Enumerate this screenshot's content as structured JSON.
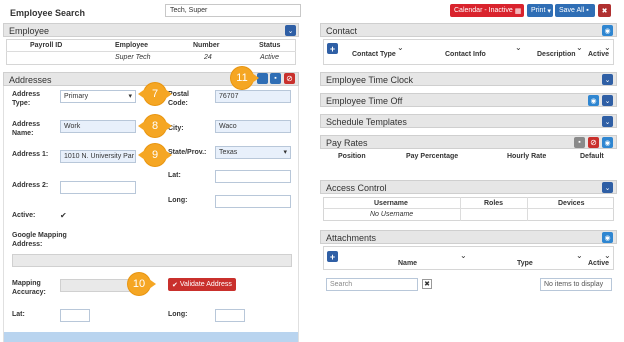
{
  "header": {
    "title": "Employee Search",
    "search_value": "Tech, Super",
    "calendar_label": "Calendar - Inactive",
    "print_label": "Print",
    "save_all_label": "Save All"
  },
  "employee": {
    "section_title": "Employee",
    "columns": [
      "Payroll ID",
      "Employee",
      "Number",
      "Status"
    ],
    "row": [
      "",
      "Super Tech",
      "24",
      "Active"
    ]
  },
  "addresses": {
    "section_title": "Addresses",
    "address_type_label": "Address Type:",
    "address_type_value": "Primary",
    "address_name_label": "Address Name:",
    "address_name_value": "Work",
    "address1_label": "Address 1:",
    "address1_value": "1010 N. University Par",
    "address2_label": "Address 2:",
    "active_label": "Active:",
    "google_label": "Google Mapping Address:",
    "mapping_label": "Mapping Accuracy:",
    "validate_label": "Validate Address",
    "lat_label": "Lat:",
    "long_label": "Long:",
    "postal_label": "Postal Code:",
    "postal_value": "76707",
    "city_label": "City:",
    "city_value": "Waco",
    "state_label": "State/Prov.:",
    "state_value": "Texas",
    "right_lat_label": "Lat:",
    "right_long_label": "Long:"
  },
  "callouts": [
    "7",
    "8",
    "9",
    "10",
    "11"
  ],
  "contact": {
    "section_title": "Contact",
    "columns": [
      "Contact Type",
      "Contact Info",
      "Description",
      "Active"
    ]
  },
  "sections": {
    "time_clock": "Employee Time Clock",
    "time_off": "Employee Time Off",
    "schedule": "Schedule Templates"
  },
  "pay_rates": {
    "section_title": "Pay Rates",
    "columns": [
      "Position",
      "Pay Percentage",
      "Hourly Rate",
      "Default"
    ]
  },
  "access": {
    "section_title": "Access Control",
    "columns": [
      "Username",
      "Roles",
      "Devices"
    ],
    "empty": "No Username"
  },
  "attachments": {
    "section_title": "Attachments",
    "columns": [
      "Name",
      "Type",
      "Active"
    ],
    "search_placeholder": "Search",
    "empty_label": "No items to display"
  }
}
